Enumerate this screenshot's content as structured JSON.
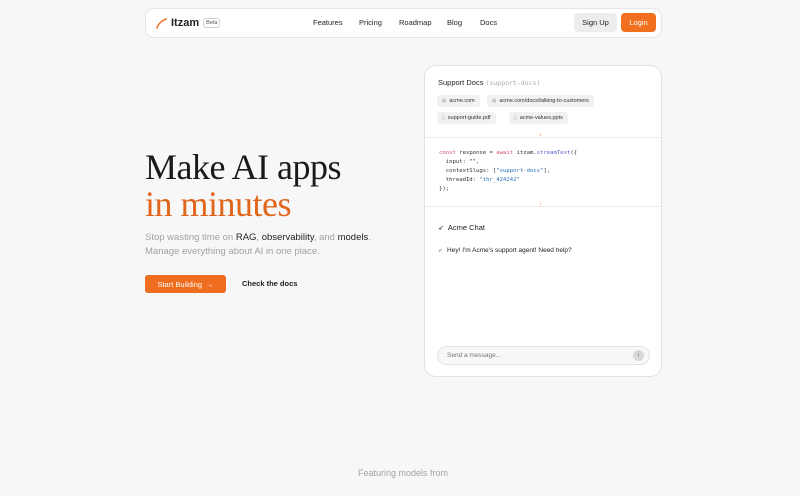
{
  "nav": {
    "brand": "Itzam",
    "badge": "Beta",
    "links": [
      "Features",
      "Pricing",
      "Roadmap",
      "Blog",
      "Docs"
    ],
    "signup_label": "Sign Up",
    "login_label": "Login"
  },
  "hero": {
    "title_line1": "Make AI apps",
    "title_line2": "in minutes",
    "sub_prefix": "Stop wasting time on ",
    "sub_rag": "RAG",
    "sub_comma1": ", ",
    "sub_obs": "observability",
    "sub_and": ", and ",
    "sub_models": "models",
    "sub_period": ".",
    "sub_line2": "Manage everything about AI in one place.",
    "start_label": "Start Building",
    "docs_label": "Check the docs"
  },
  "card": {
    "title": "Support Docs",
    "slug": "(support-docs)",
    "sources": [
      {
        "label": "acme.com",
        "icon": "globe-icon"
      },
      {
        "label": "acme.com/docs/talking-to-customers",
        "icon": "globe-icon"
      },
      {
        "label": "support-guide.pdf",
        "icon": "file-icon"
      },
      {
        "label": "acme-values.pptx",
        "icon": "file-icon"
      }
    ],
    "code": {
      "l1_kw": "const",
      "l1_var": " response = ",
      "l1_await": "await",
      "l1_obj": " itzam.",
      "l1_fn": "streamText",
      "l1_end": "({",
      "l2": "  input: \"\",",
      "l3_pre": "  contextSlugs: [",
      "l3_str": "\"support-docs\"",
      "l3_end": "],",
      "l4_pre": "  threadId: ",
      "l4_str": "\"thr_424242\"",
      "l5": "});"
    },
    "chat_title": "Acme Chat",
    "chat_message": "Hey! I'm Acme's support agent! Need help?",
    "input_placeholder": "Send a message..."
  },
  "footer": {
    "featuring": "Featuring models from"
  },
  "colors": {
    "accent": "#ef6d1f",
    "title_accent": "#e0661d"
  }
}
